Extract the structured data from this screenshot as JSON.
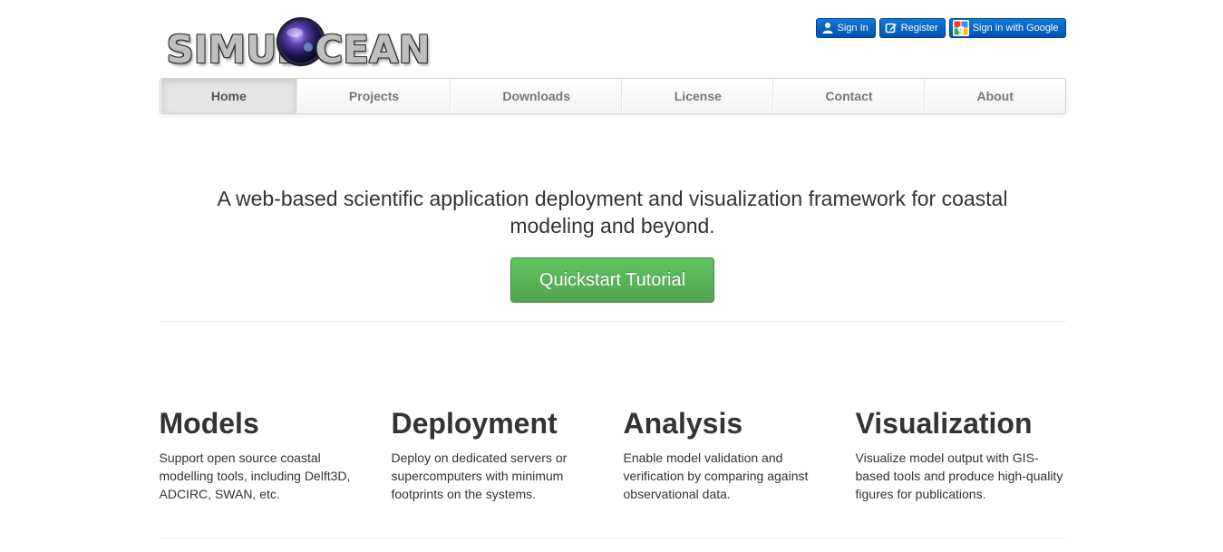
{
  "logo": {
    "text_left": "SIMUL",
    "text_right": "CEAN"
  },
  "auth": {
    "sign_in": "Sign In",
    "register": "Register",
    "google": "Sign in with Google"
  },
  "nav": {
    "items": [
      "Home",
      "Projects",
      "Downloads",
      "License",
      "Contact",
      "About"
    ],
    "active": "Home"
  },
  "hero": {
    "tagline": "A web-based scientific application deployment and visualization framework for coastal modeling and beyond.",
    "cta": "Quickstart Tutorial"
  },
  "features": [
    {
      "title": "Models",
      "text": "Support open source coastal modelling tools, including Delft3D, ADCIRC, SWAN, etc."
    },
    {
      "title": "Deployment",
      "text": "Deploy on dedicated servers or supercomputers with minimum footprints on the systems."
    },
    {
      "title": "Analysis",
      "text": "Enable model validation and verification by comparing against observational data."
    },
    {
      "title": "Visualization",
      "text": "Visualize model output with GIS-based tools and produce high-quality figures for publications."
    }
  ],
  "colors": {
    "auth_button": "#0058bd",
    "cta": "#5bb75b",
    "nav_active_bg": "#e5e5e5"
  },
  "icons": {
    "sign_in": "user-icon",
    "register": "edit-icon",
    "google": "google-icon",
    "logo_orb": "globe-lens-icon"
  }
}
